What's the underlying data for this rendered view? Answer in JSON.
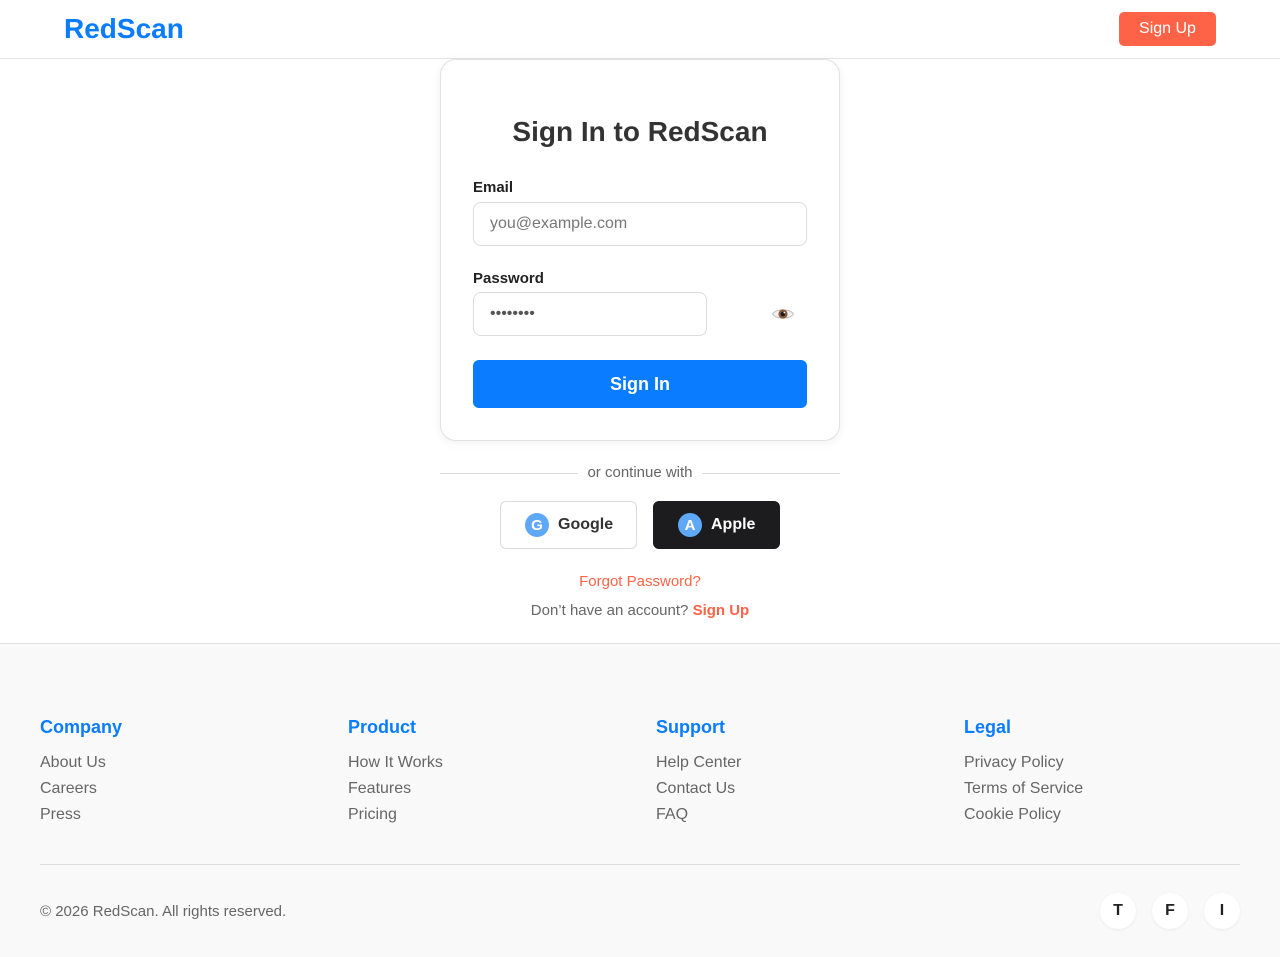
{
  "header": {
    "logo": "RedScan",
    "signup_label": "Sign Up"
  },
  "signin": {
    "title": "Sign In to RedScan",
    "email_label": "Email",
    "email_placeholder": "you@example.com",
    "password_label": "Password",
    "password_value": "••••••••",
    "toggle_icon": "eye-icon",
    "submit_label": "Sign In"
  },
  "social": {
    "divider_text": "or continue with",
    "google": {
      "icon_letter": "G",
      "label": "Google"
    },
    "apple": {
      "icon_letter": "A",
      "label": "Apple"
    }
  },
  "links": {
    "forgot": "Forgot Password?",
    "no_account": "Don’t have an account?",
    "signup": "Sign Up"
  },
  "footer": {
    "columns": [
      {
        "heading": "Company",
        "links": [
          "About Us",
          "Careers",
          "Press"
        ]
      },
      {
        "heading": "Product",
        "links": [
          "How It Works",
          "Features",
          "Pricing"
        ]
      },
      {
        "heading": "Support",
        "links": [
          "Help Center",
          "Contact Us",
          "FAQ"
        ]
      },
      {
        "heading": "Legal",
        "links": [
          "Privacy Policy",
          "Terms of Service",
          "Cookie Policy"
        ]
      }
    ],
    "copyright": "© 2026 RedScan. All rights reserved.",
    "social": [
      "T",
      "F",
      "I"
    ]
  },
  "colors": {
    "brand_blue": "#0a7cff",
    "accent_red": "#ff6347",
    "dark": "#1c1c1e",
    "footer_bg": "#f9f9f9"
  }
}
